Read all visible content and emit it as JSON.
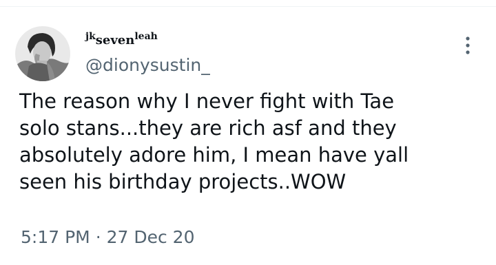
{
  "author": {
    "display_name_prefix": "jk",
    "display_name_main": "seven",
    "display_name_suffix": "leah",
    "handle": "@dionysustin_",
    "avatar_icon": "profile-photo"
  },
  "tweet": {
    "text": "The reason why I never fight with Tae\nsolo stans...they are rich asf and they\nabsolutely adore him, I mean have yall\nseen his birthday projects..WOW"
  },
  "meta": {
    "time": "5:17 PM",
    "separator": "·",
    "date": "27 Dec 20"
  },
  "icons": {
    "more": "more-options-icon"
  },
  "colors": {
    "text": "#0f1419",
    "secondary_text": "#536471",
    "divider": "#eff3f4"
  }
}
